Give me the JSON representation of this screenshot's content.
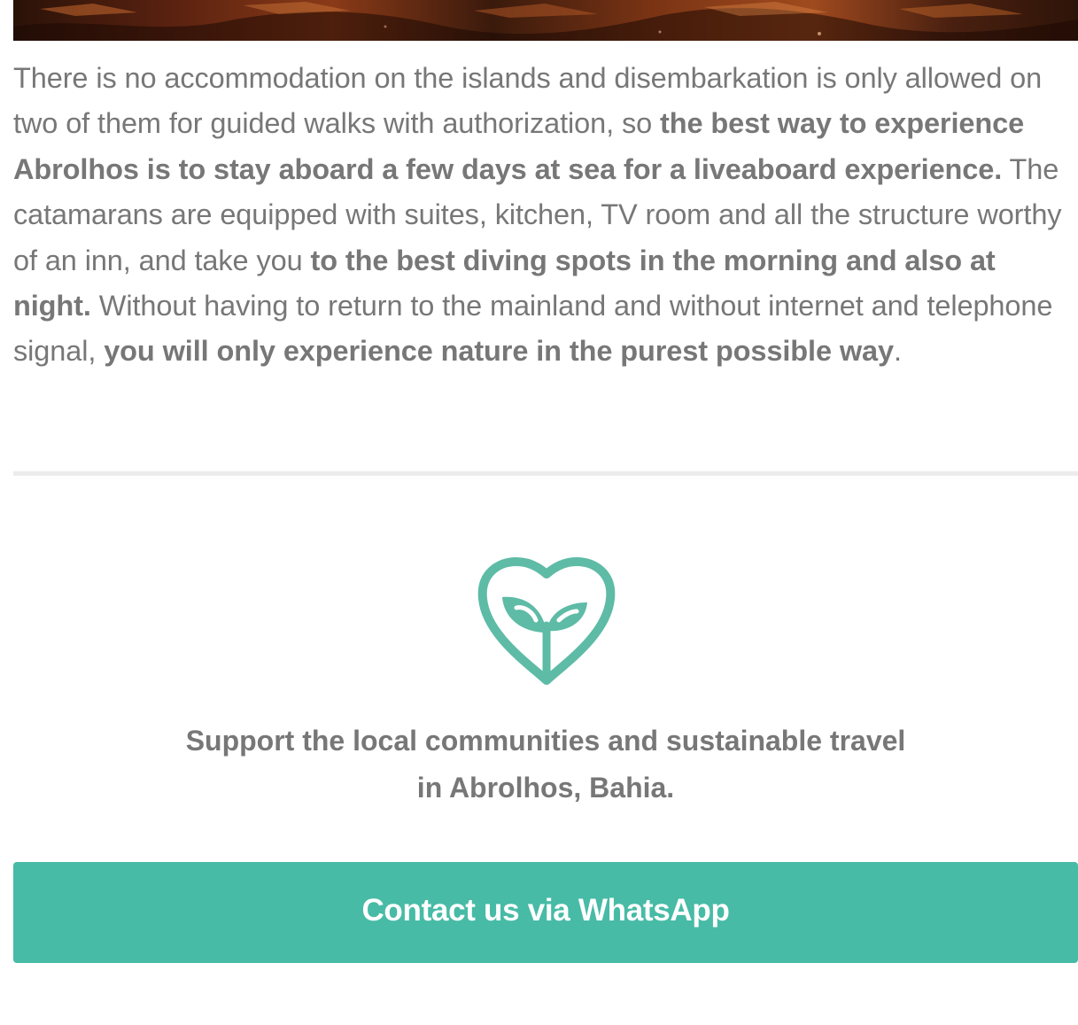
{
  "article": {
    "p1": "There is no accommodation on the islands and disembarkation is only allowed on two of them for guided walks with authorization, so ",
    "b1": "the best way to experience Abrolhos is to stay aboard a few days at sea for a liveaboard experience.",
    "p2": " The catamarans are equipped with suites, kitchen, TV room and all the structure worthy of an inn, and take you ",
    "b2": "to the best diving spots in the morning and also at night.",
    "p3": " Without having to return to the mainland and without internet and telephone signal, ",
    "b3": "you will only experience nature in the purest possible way",
    "p4": "."
  },
  "support": {
    "icon": "heart-sprout-icon",
    "line1": "Support the local communities and sustainable travel",
    "line2": "in Abrolhos, Bahia."
  },
  "cta": {
    "label": "Contact us via WhatsApp"
  },
  "colors": {
    "accent": "#47bba6",
    "icon": "#5ebba6",
    "text": "#777777",
    "divider": "#ececec"
  }
}
